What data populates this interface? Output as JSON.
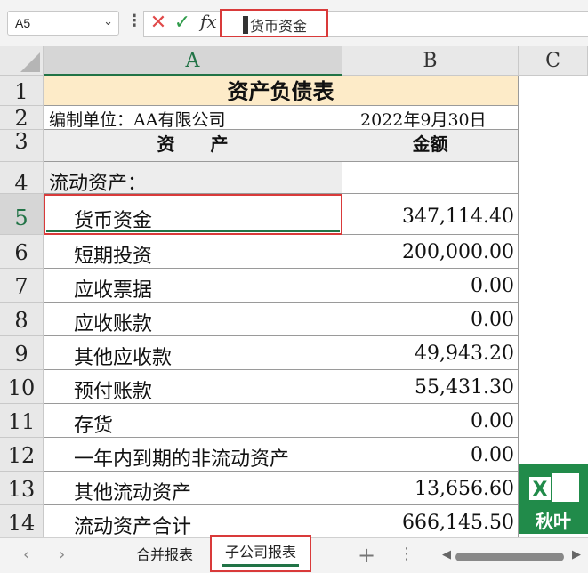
{
  "formula_bar": {
    "name_box": "A5",
    "formula": "货币资金"
  },
  "columns": [
    "A",
    "B",
    "C"
  ],
  "rows": [
    {
      "num": "1",
      "a": "资产负债表",
      "b": ""
    },
    {
      "num": "2",
      "a": "编制单位：AA有限公司",
      "b": "2022年9月30日"
    },
    {
      "num": "3",
      "a": "资　　产",
      "b": "金额"
    },
    {
      "num": "4",
      "a": "流动资产：",
      "b": ""
    },
    {
      "num": "5",
      "a": "货币资金",
      "b": "347,114.40"
    },
    {
      "num": "6",
      "a": "短期投资",
      "b": "200,000.00"
    },
    {
      "num": "7",
      "a": "应收票据",
      "b": "0.00"
    },
    {
      "num": "8",
      "a": "应收账款",
      "b": "0.00"
    },
    {
      "num": "9",
      "a": "其他应收款",
      "b": "49,943.20"
    },
    {
      "num": "10",
      "a": "预付账款",
      "b": "55,431.30"
    },
    {
      "num": "11",
      "a": "存货",
      "b": "0.00"
    },
    {
      "num": "12",
      "a": "一年内到期的非流动资产",
      "b": "0.00"
    },
    {
      "num": "13",
      "a": "其他流动资产",
      "b": "13,656.60"
    },
    {
      "num": "14",
      "a": "流动资产合计",
      "b": "666,145.50"
    }
  ],
  "sheet_tabs": [
    "合并报表",
    "子公司报表"
  ],
  "active_sheet": "子公司报表",
  "logo": {
    "letter": "X",
    "text": "秋叶"
  },
  "colors": {
    "accent_green": "#217346",
    "highlight_red": "#d93a3a",
    "title_fill": "#fdebc8"
  }
}
